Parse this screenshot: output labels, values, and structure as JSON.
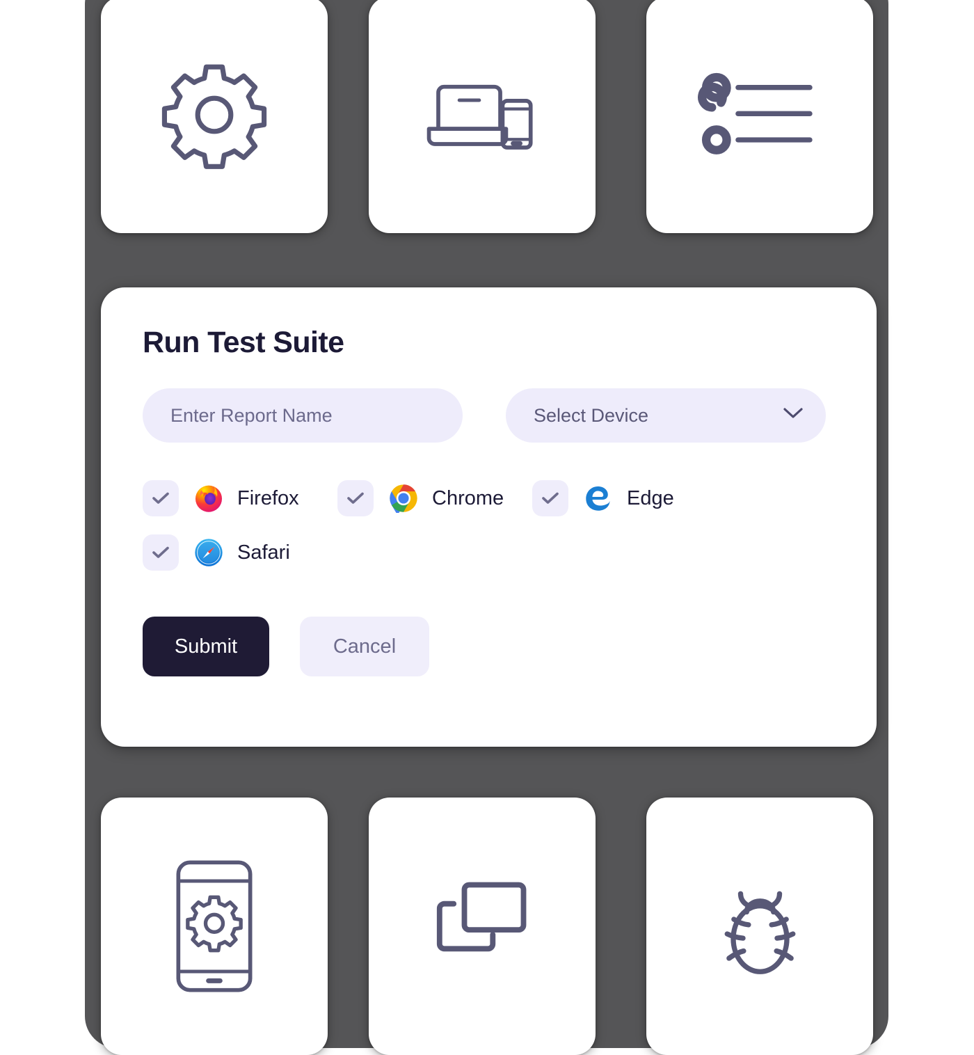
{
  "theme": {
    "backdrop_color": "#555557",
    "card_color": "#ffffff",
    "accent_dark": "#1f1b35",
    "icon_stroke": "#585876",
    "field_bg": "#eeecfb",
    "title_color": "#1c1a36",
    "muted_text": "#6d6b8c"
  },
  "top_cards": [
    {
      "name": "settings-gear",
      "icon": "gear-icon"
    },
    {
      "name": "devices",
      "icon": "laptop-and-phone-icon"
    },
    {
      "name": "test-list",
      "icon": "bulleted-list-icon"
    }
  ],
  "bottom_cards": [
    {
      "name": "mobile-settings",
      "icon": "phone-with-gear-icon"
    },
    {
      "name": "screen-sizes",
      "icon": "overlapping-screens-icon"
    },
    {
      "name": "bug-report",
      "icon": "bug-icon"
    }
  ],
  "dialog": {
    "title": "Run Test Suite",
    "report_name": {
      "placeholder": "Enter Report Name",
      "value": ""
    },
    "device_select": {
      "label": "Select Device",
      "chevron": "chevron-down-icon"
    },
    "browsers": [
      {
        "label": "Firefox",
        "logo": "firefox-logo",
        "checked": true
      },
      {
        "label": "Chrome",
        "logo": "chrome-logo",
        "checked": true
      },
      {
        "label": "Edge",
        "logo": "edge-logo",
        "checked": true
      },
      {
        "label": "Safari",
        "logo": "safari-logo",
        "checked": true
      }
    ],
    "submit_label": "Submit",
    "cancel_label": "Cancel"
  }
}
